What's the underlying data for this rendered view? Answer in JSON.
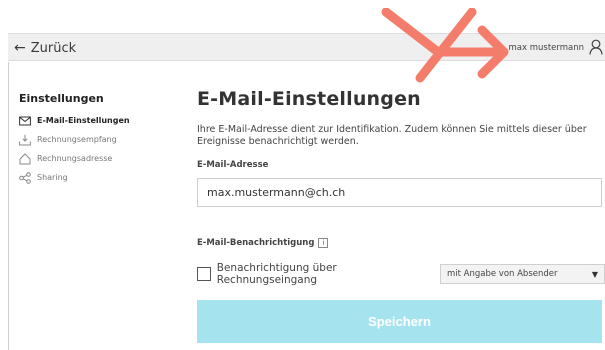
{
  "topbar": {
    "back_label": "Zurück",
    "username": "max mustermann"
  },
  "sidebar": {
    "title": "Einstellungen",
    "items": [
      {
        "label": "E-Mail-Einstellungen",
        "icon": "mail-icon",
        "active": true
      },
      {
        "label": "Rechnungsempfang",
        "icon": "inbox-tray-icon",
        "active": false
      },
      {
        "label": "Rechnungsadresse",
        "icon": "home-icon",
        "active": false
      },
      {
        "label": "Sharing",
        "icon": "share-icon",
        "active": false
      }
    ]
  },
  "main": {
    "title": "E-Mail-Einstellungen",
    "description": "Ihre E-Mail-Adresse dient zur Identifikation. Zudem können Sie mittels dieser über Ereignisse benachrichtigt werden.",
    "email_label": "E-Mail-Adresse",
    "email_value": "max.mustermann@ch.ch",
    "notification_label": "E-Mail-Benachrichtigung",
    "info_glyph": "i",
    "checkbox_label": "Benachrichtigung über Rechnungseingang",
    "checkbox_checked": false,
    "select_value": "mit Angabe von Absender",
    "save_label": "Speichern"
  },
  "colors": {
    "save_button": "#a5e4ef",
    "annotation_arrow": "#f47c6a",
    "topbar_bg": "#efefef"
  }
}
